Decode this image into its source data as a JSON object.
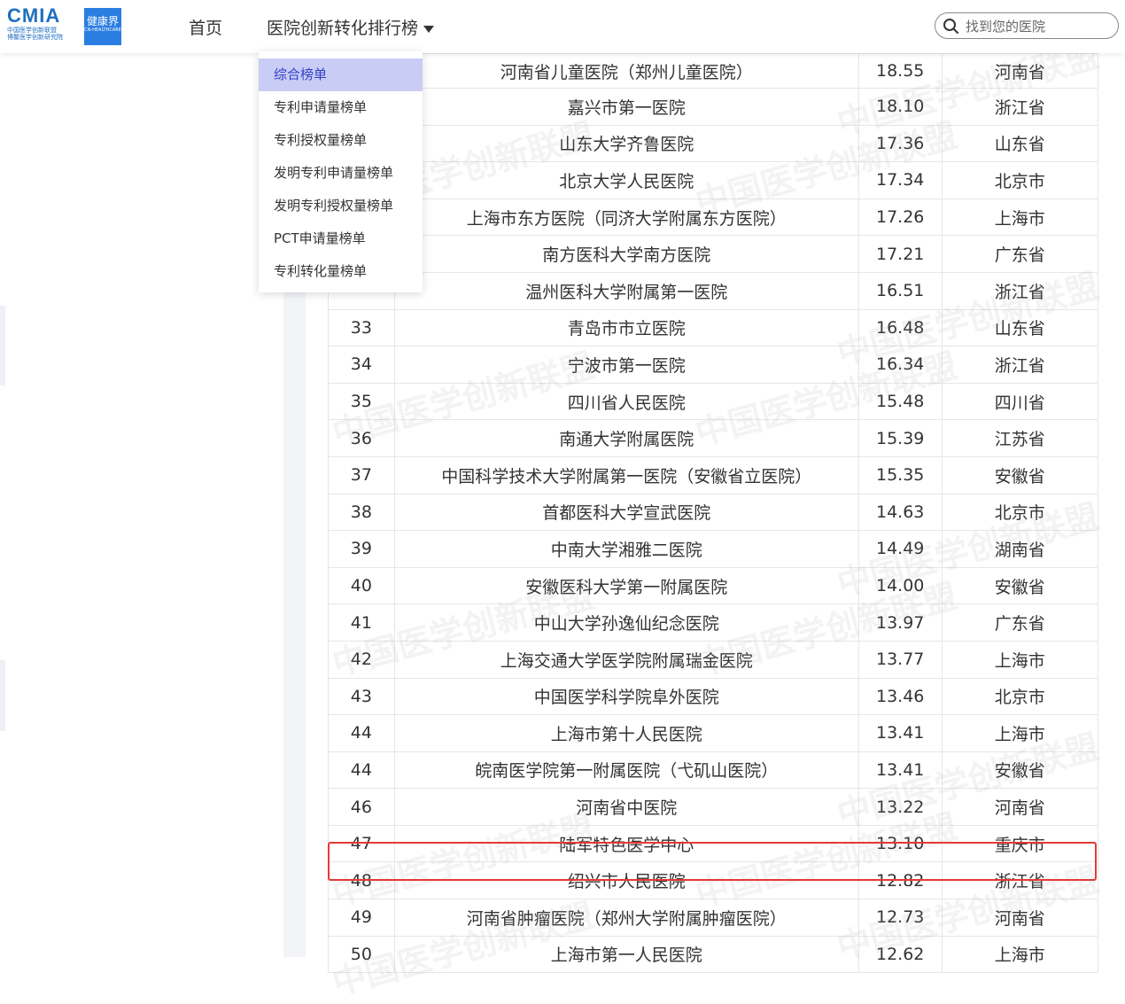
{
  "header": {
    "logo_cmia": "CMIA",
    "logo_cmia_sub1": "中国医学创新联盟",
    "logo_cmia_sub2": "博鳌医学创新研究院",
    "logo_jkj": "健康界",
    "logo_jkj_en": "CN-HEALTHCARE",
    "nav_home": "首页",
    "nav_rank": "医院创新转化排行榜",
    "search_placeholder": "找到您的医院",
    "search_icon": "search-icon"
  },
  "dropdown": {
    "items": [
      "综合榜单",
      "专利申请量榜单",
      "专利授权量榜单",
      "发明专利申请量榜单",
      "发明专利授权量榜单",
      "PCT申请量榜单",
      "专利转化量榜单"
    ],
    "active_index": 0
  },
  "watermark": "中国医学创新联盟",
  "table": {
    "rows": [
      {
        "rank": "",
        "name": "河南省儿童医院（郑州儿童医院）",
        "score": "18.55",
        "province": "河南省"
      },
      {
        "rank": "",
        "name": "嘉兴市第一医院",
        "score": "18.10",
        "province": "浙江省"
      },
      {
        "rank": "",
        "name": "山东大学齐鲁医院",
        "score": "17.36",
        "province": "山东省"
      },
      {
        "rank": "",
        "name": "北京大学人民医院",
        "score": "17.34",
        "province": "北京市"
      },
      {
        "rank": "",
        "name": "上海市东方医院（同济大学附属东方医院）",
        "score": "17.26",
        "province": "上海市"
      },
      {
        "rank": "",
        "name": "南方医科大学南方医院",
        "score": "17.21",
        "province": "广东省"
      },
      {
        "rank": "",
        "name": "温州医科大学附属第一医院",
        "score": "16.51",
        "province": "浙江省"
      },
      {
        "rank": "33",
        "name": "青岛市市立医院",
        "score": "16.48",
        "province": "山东省"
      },
      {
        "rank": "34",
        "name": "宁波市第一医院",
        "score": "16.34",
        "province": "浙江省"
      },
      {
        "rank": "35",
        "name": "四川省人民医院",
        "score": "15.48",
        "province": "四川省"
      },
      {
        "rank": "36",
        "name": "南通大学附属医院",
        "score": "15.39",
        "province": "江苏省"
      },
      {
        "rank": "37",
        "name": "中国科学技术大学附属第一医院（安徽省立医院）",
        "score": "15.35",
        "province": "安徽省"
      },
      {
        "rank": "38",
        "name": "首都医科大学宣武医院",
        "score": "14.63",
        "province": "北京市"
      },
      {
        "rank": "39",
        "name": "中南大学湘雅二医院",
        "score": "14.49",
        "province": "湖南省"
      },
      {
        "rank": "40",
        "name": "安徽医科大学第一附属医院",
        "score": "14.00",
        "province": "安徽省"
      },
      {
        "rank": "41",
        "name": "中山大学孙逸仙纪念医院",
        "score": "13.97",
        "province": "广东省"
      },
      {
        "rank": "42",
        "name": "上海交通大学医学院附属瑞金医院",
        "score": "13.77",
        "province": "上海市"
      },
      {
        "rank": "43",
        "name": "中国医学科学院阜外医院",
        "score": "13.46",
        "province": "北京市"
      },
      {
        "rank": "44",
        "name": "上海市第十人民医院",
        "score": "13.41",
        "province": "上海市"
      },
      {
        "rank": "44",
        "name": "皖南医学院第一附属医院（弋矶山医院）",
        "score": "13.41",
        "province": "安徽省"
      },
      {
        "rank": "46",
        "name": "河南省中医院",
        "score": "13.22",
        "province": "河南省"
      },
      {
        "rank": "47",
        "name": "陆军特色医学中心",
        "score": "13.10",
        "province": "重庆市"
      },
      {
        "rank": "48",
        "name": "绍兴市人民医院",
        "score": "12.82",
        "province": "浙江省"
      },
      {
        "rank": "49",
        "name": "河南省肿瘤医院（郑州大学附属肿瘤医院）",
        "score": "12.73",
        "province": "河南省"
      },
      {
        "rank": "50",
        "name": "上海市第一人民医院",
        "score": "12.62",
        "province": "上海市"
      }
    ],
    "highlight_rank": "48",
    "highlight_color": "#e53935"
  }
}
